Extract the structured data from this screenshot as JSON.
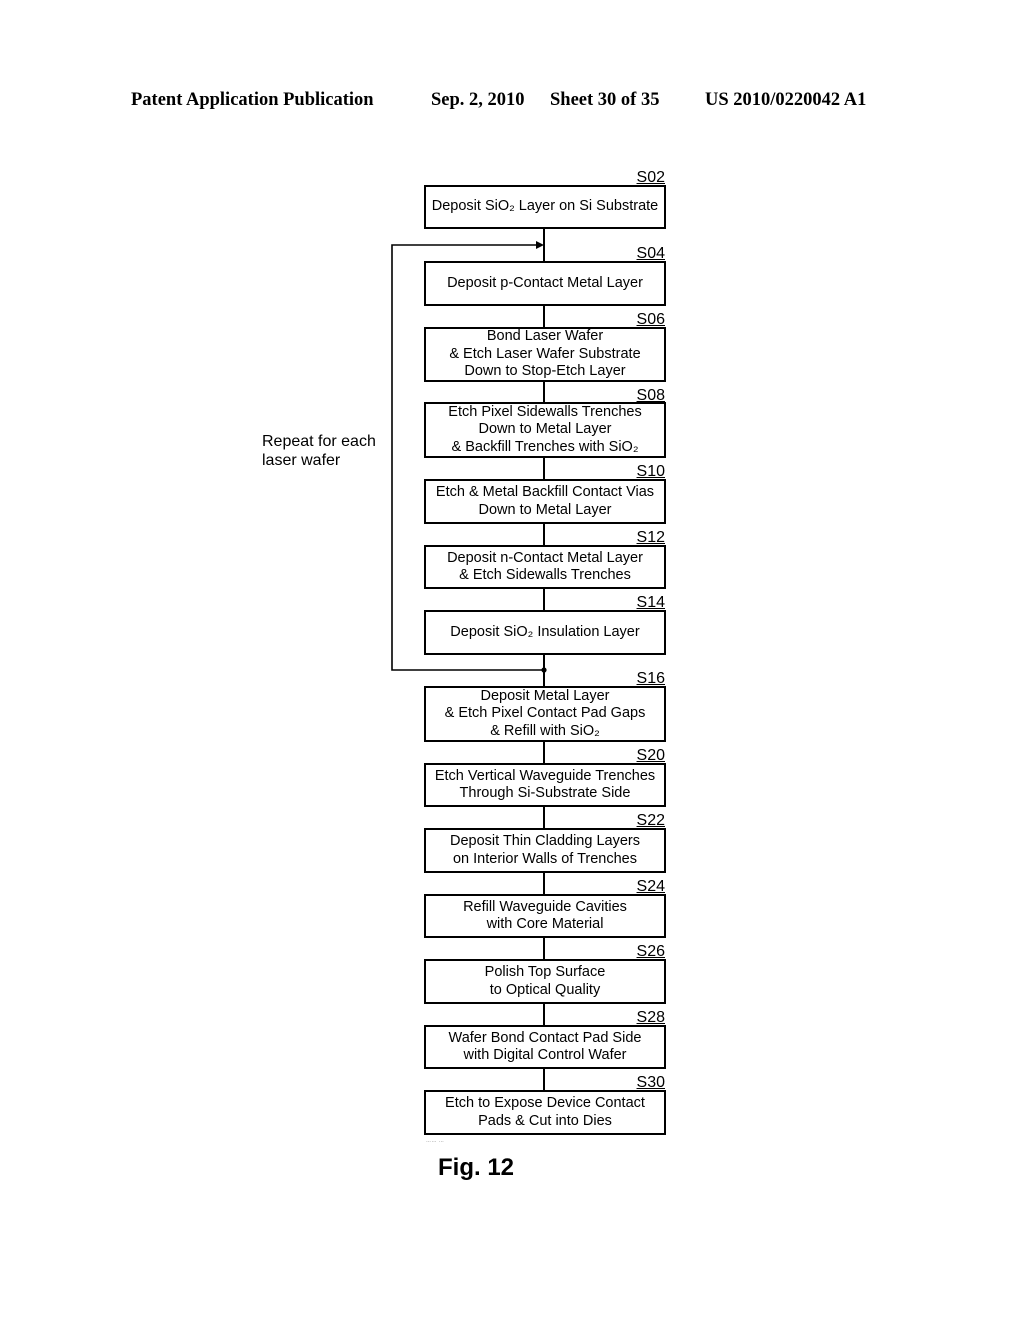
{
  "header": {
    "publication": "Patent Application Publication",
    "date": "Sep. 2, 2010",
    "sheet": "Sheet 30 of 35",
    "number": "US 2010/0220042 A1"
  },
  "loop_annotation": "Repeat for each\nlaser wafer",
  "steps": [
    {
      "id": "S02",
      "text": "Deposit SiO₂ Layer on Si Substrate"
    },
    {
      "id": "S04",
      "text": "Deposit p-Contact Metal Layer"
    },
    {
      "id": "S06",
      "text": "Bond Laser Wafer\n& Etch Laser Wafer Substrate\nDown to Stop-Etch Layer"
    },
    {
      "id": "S08",
      "text": "Etch Pixel Sidewalls Trenches\nDown to Metal Layer\n& Backfill Trenches with SiO₂"
    },
    {
      "id": "S10",
      "text": "Etch & Metal Backfill Contact Vias\nDown to Metal Layer"
    },
    {
      "id": "S12",
      "text": "Deposit n-Contact Metal Layer\n& Etch Sidewalls Trenches"
    },
    {
      "id": "S14",
      "text": "Deposit SiO₂ Insulation Layer"
    },
    {
      "id": "S16",
      "text": "Deposit Metal Layer\n& Etch Pixel Contact Pad Gaps\n& Refill with SiO₂"
    },
    {
      "id": "S20",
      "text": "Etch Vertical Waveguide Trenches\nThrough Si-Substrate Side"
    },
    {
      "id": "S22",
      "text": "Deposit Thin Cladding Layers\non Interior Walls of Trenches"
    },
    {
      "id": "S24",
      "text": "Refill Waveguide Cavities\nwith Core Material"
    },
    {
      "id": "S26",
      "text": "Polish Top Surface\nto Optical Quality"
    },
    {
      "id": "S28",
      "text": "Wafer Bond Contact Pad Side\nwith Digital Control Wafer"
    },
    {
      "id": "S30",
      "text": "Etch to Expose Device Contact\nPads & Cut into Dies"
    }
  ],
  "figure_label": "Fig. 12",
  "footnote": "…… …"
}
